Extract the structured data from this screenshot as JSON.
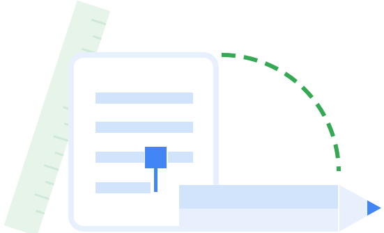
{
  "illustration": {
    "colors": {
      "ruler_fill": "#e6f4ea",
      "ruler_ticks": "#ceead6",
      "document_border": "#e8f0fe",
      "document_fill": "#ffffff",
      "text_lines": "#d2e3fc",
      "cursor": "#4285f4",
      "dashed_arc": "#34a853",
      "pencil_body_top": "#d2e3fc",
      "pencil_body_bottom": "#e8f0fe",
      "pencil_tip_wood": "#e8f0fe",
      "pencil_lead": "#4285f4"
    },
    "icons": [
      "ruler-icon",
      "document-icon",
      "text-cursor-icon",
      "pencil-icon",
      "dashed-arc"
    ]
  }
}
